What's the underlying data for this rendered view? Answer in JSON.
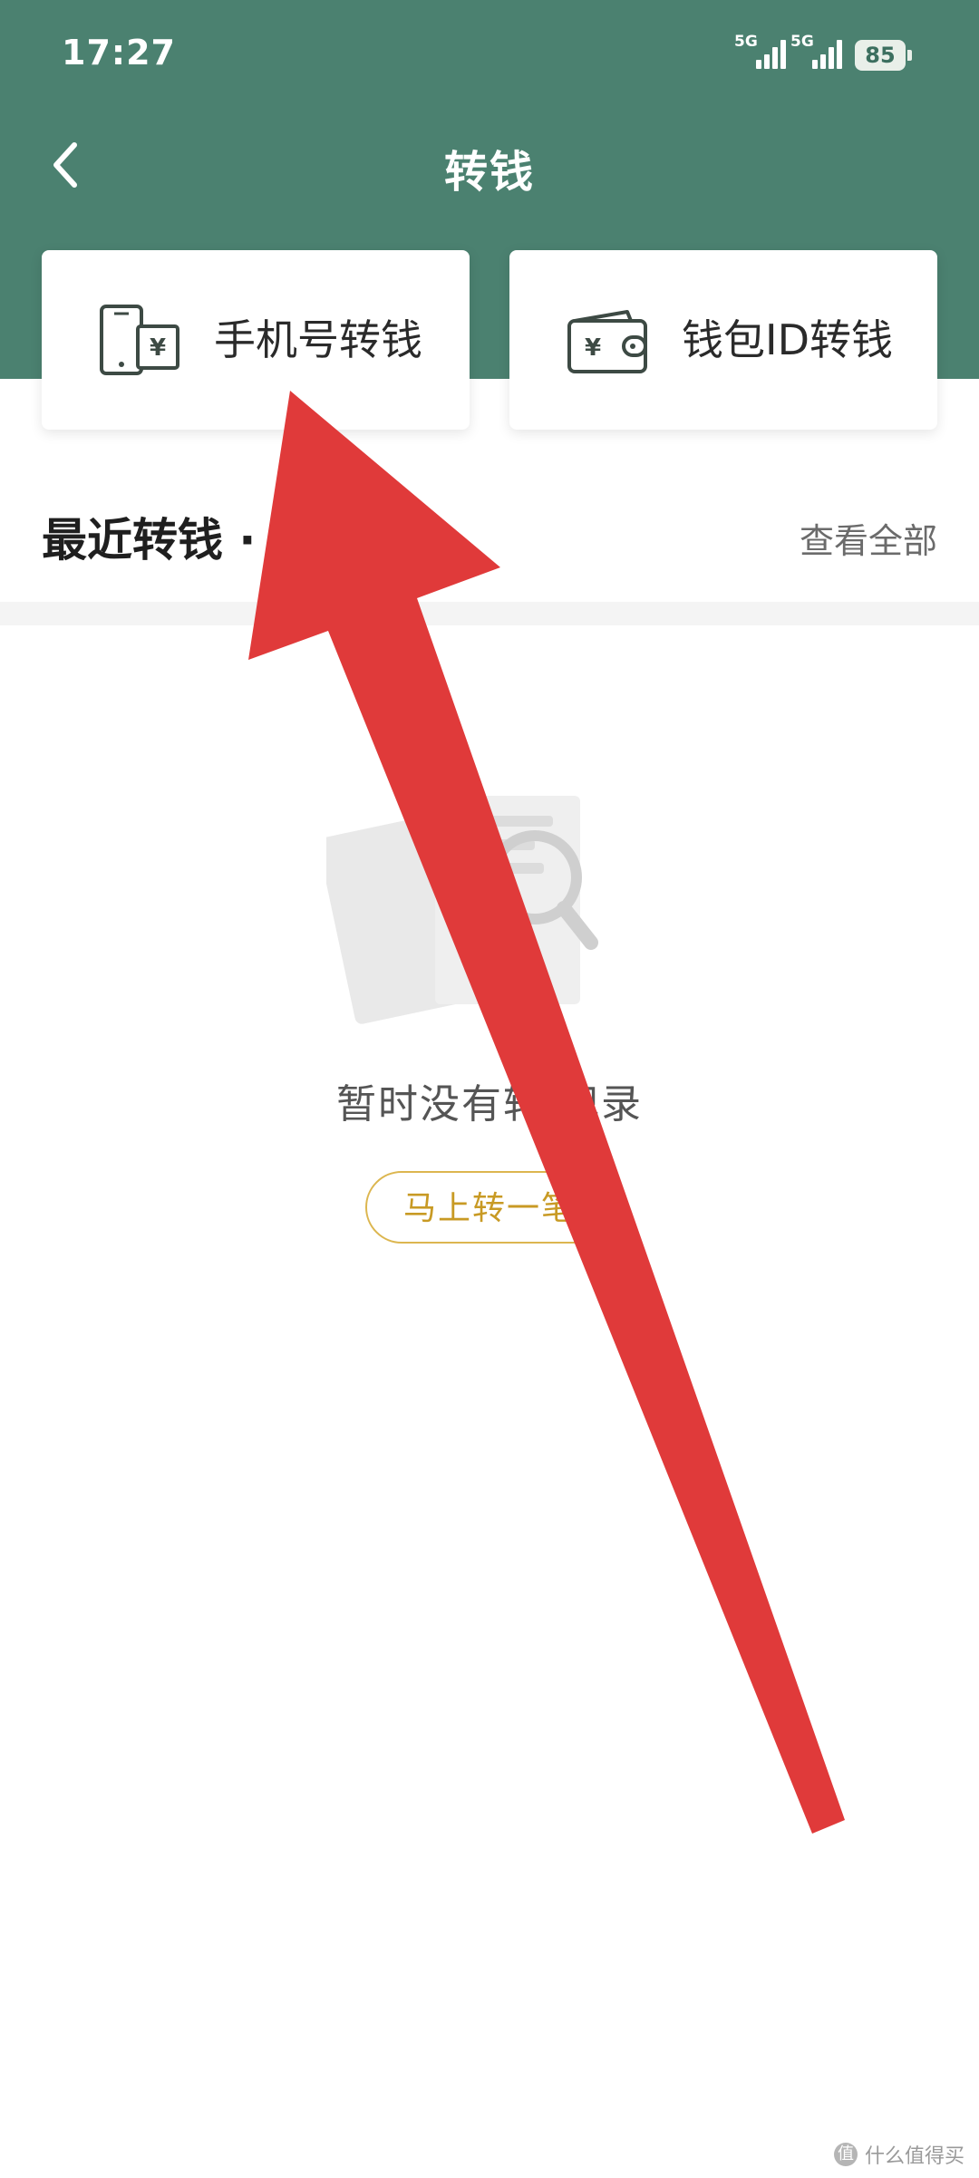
{
  "status_bar": {
    "time": "17:27",
    "network_1": "5G",
    "network_2": "5G",
    "battery": "85"
  },
  "nav": {
    "title": "转钱",
    "back_icon": "chevron-left-icon"
  },
  "cards": [
    {
      "label": "手机号转钱",
      "icon": "phone-transfer-icon"
    },
    {
      "label": "钱包ID转钱",
      "icon": "wallet-icon"
    }
  ],
  "recent": {
    "title": "最近转钱 · 转",
    "view_all": "查看全部"
  },
  "empty_state": {
    "text": "暂时没有转 记录",
    "button": "马上转一笔"
  },
  "watermark": {
    "text": "什么值得买"
  },
  "colors": {
    "header_green": "#4b8170",
    "accent_gold": "#dcb64f",
    "arrow_red": "#e03a3a"
  }
}
